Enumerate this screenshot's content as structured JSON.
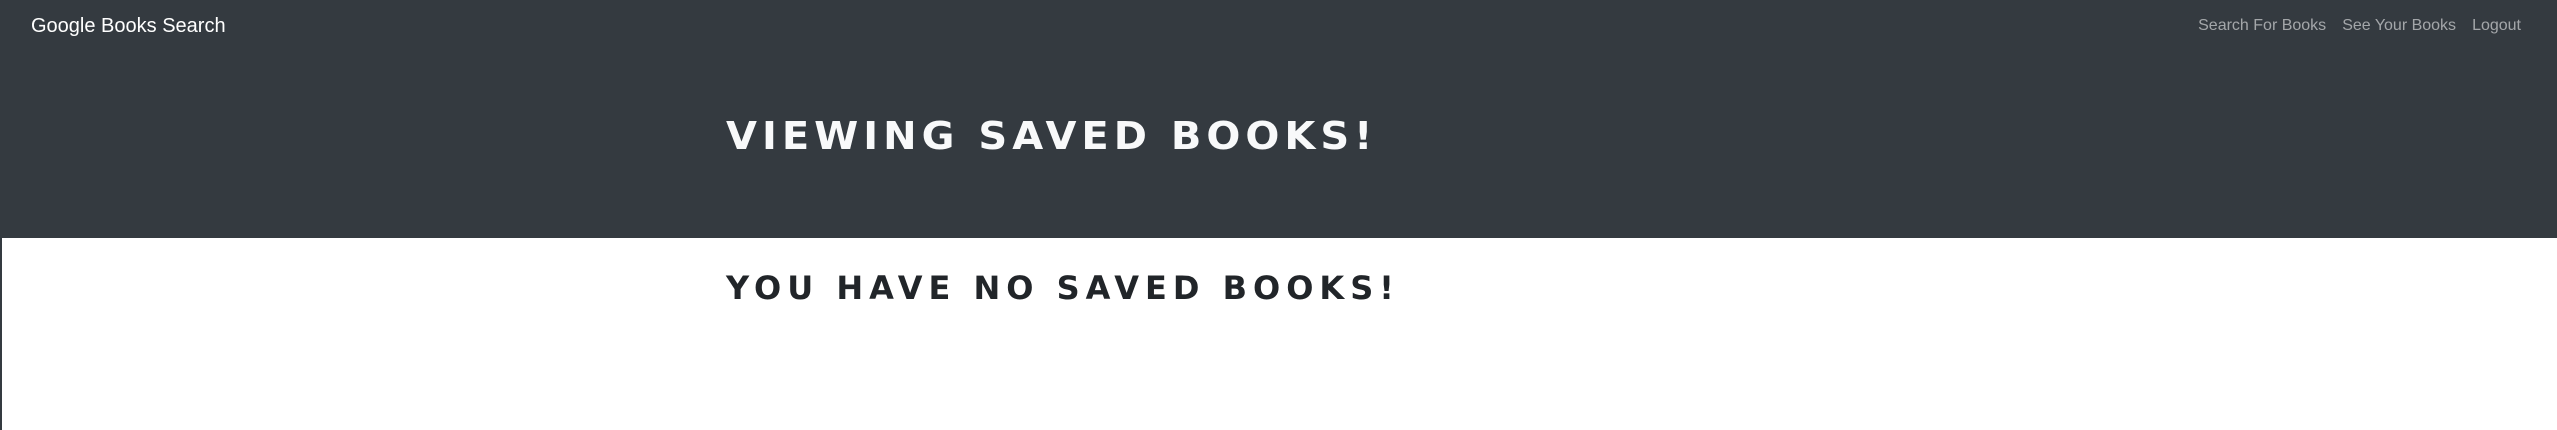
{
  "navbar": {
    "brand": "Google Books Search",
    "links": [
      {
        "label": "Search For Books"
      },
      {
        "label": "See Your Books"
      },
      {
        "label": "Logout"
      }
    ]
  },
  "hero": {
    "title": "VIEWING SAVED BOOKS!"
  },
  "main": {
    "empty_message": "YOU HAVE NO SAVED BOOKS!"
  },
  "colors": {
    "navbar_bg": "#343a40",
    "nav_link": "#9a9da0",
    "hero_text": "#f8f9fa",
    "body_text": "#212529"
  }
}
